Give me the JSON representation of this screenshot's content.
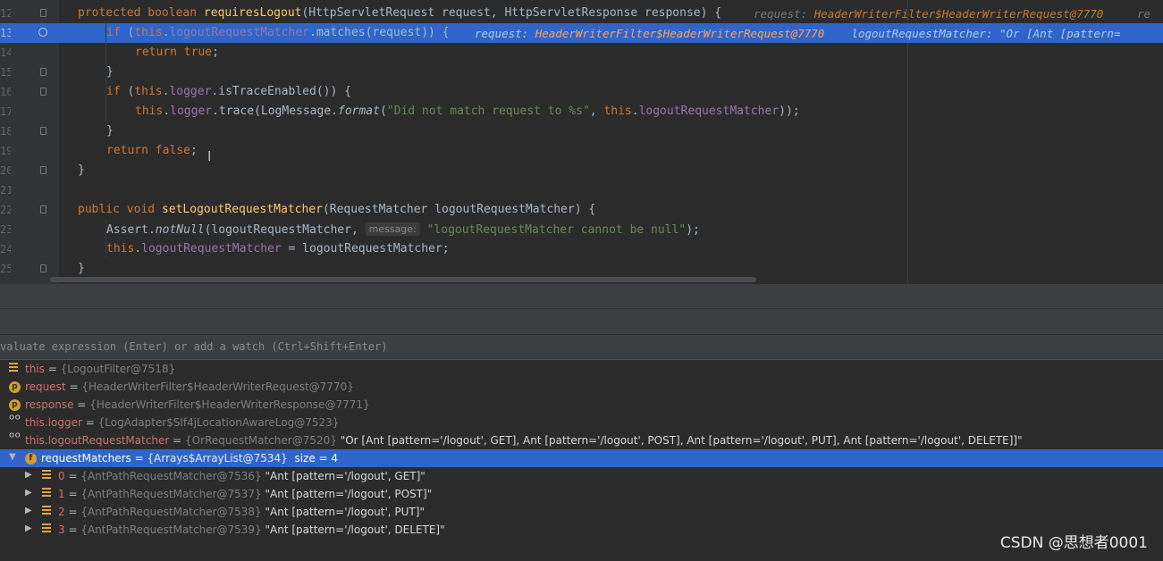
{
  "editor": {
    "lines": [
      {
        "num": "12",
        "code": [
          [
            "kw",
            "protected "
          ],
          [
            "kw",
            "boolean "
          ],
          [
            "fn",
            "requiresLogout"
          ],
          [
            "",
            "(HttpServletRequest request, HttpServletResponse response) {"
          ]
        ],
        "hints": [
          [
            "k",
            "request: "
          ],
          [
            "v",
            "HeaderWriterFilter$HeaderWriterRequest@7770"
          ],
          [
            "k",
            "     re"
          ]
        ]
      },
      {
        "num": "13",
        "code": [
          [
            "kw",
            "if "
          ],
          [
            "",
            "("
          ],
          [
            "kw",
            "this"
          ],
          [
            "",
            "."
          ],
          [
            "fld",
            "logoutRequestMatcher"
          ],
          [
            "",
            ".matches(request)) {"
          ]
        ],
        "hints": [
          [
            "k",
            "request: "
          ],
          [
            "v",
            "HeaderWriterFilter$HeaderWriterRequest@7770"
          ],
          [
            "k",
            "    logoutRequestMatcher: \"Or [Ant [pattern="
          ]
        ]
      },
      {
        "num": "14",
        "code": [
          [
            "kw",
            "return "
          ],
          [
            "kw",
            "true"
          ],
          [
            "",
            ";"
          ]
        ],
        "hints": []
      },
      {
        "num": "15",
        "code": [
          [
            "",
            "}"
          ]
        ],
        "hints": []
      },
      {
        "num": "16",
        "code": [
          [
            "kw",
            "if "
          ],
          [
            "",
            "("
          ],
          [
            "kw",
            "this"
          ],
          [
            "",
            "."
          ],
          [
            "fld",
            "logger"
          ],
          [
            "",
            ".isTraceEnabled()) {"
          ]
        ],
        "hints": []
      },
      {
        "num": "17",
        "code": [
          [
            "kw",
            "this"
          ],
          [
            "",
            "."
          ],
          [
            "fld",
            "logger"
          ],
          [
            "",
            ".trace(LogMessage."
          ],
          [
            "it",
            "format"
          ],
          [
            "",
            "("
          ],
          [
            "str",
            "\"Did not match request to %s\""
          ],
          [
            "",
            ", "
          ],
          [
            "kw",
            "this"
          ],
          [
            "",
            "."
          ],
          [
            "fld",
            "logoutRequestMatcher"
          ],
          [
            "",
            "));"
          ]
        ],
        "hints": []
      },
      {
        "num": "18",
        "code": [
          [
            "",
            "}"
          ]
        ],
        "hints": []
      },
      {
        "num": "19",
        "code": [
          [
            "kw",
            "return "
          ],
          [
            "kw",
            "false"
          ],
          [
            "",
            ";"
          ]
        ],
        "hints": []
      },
      {
        "num": "20",
        "code": [
          [
            "",
            "}"
          ]
        ],
        "hints": []
      },
      {
        "num": "21",
        "code": [],
        "hints": []
      },
      {
        "num": "22",
        "code": [
          [
            "kw",
            "public "
          ],
          [
            "kw",
            "void "
          ],
          [
            "fn",
            "setLogoutRequestMatcher"
          ],
          [
            "",
            "(RequestMatcher logoutRequestMatcher) {"
          ]
        ],
        "hints": []
      },
      {
        "num": "23",
        "code": [
          [
            "",
            "Assert."
          ],
          [
            "it",
            "notNull"
          ],
          [
            "",
            "(logoutRequestMatcher, "
          ],
          [
            "param",
            "message:"
          ],
          [
            "str",
            "\"logoutRequestMatcher cannot be null\""
          ],
          [
            "",
            ");"
          ]
        ],
        "hints": []
      },
      {
        "num": "24",
        "code": [
          [
            "kw",
            "this"
          ],
          [
            "",
            "."
          ],
          [
            "fld",
            "logoutRequestMatcher"
          ],
          [
            "",
            " = logoutRequestMatcher;"
          ]
        ],
        "hints": []
      },
      {
        "num": "25",
        "code": [
          [
            "",
            "}"
          ]
        ],
        "hints": []
      }
    ]
  },
  "debugger": {
    "eval_placeholder": "valuate expression (Enter) or add a watch (Ctrl+Shift+Enter)",
    "variables": [
      {
        "icon": "bars-icon",
        "name": "this",
        "ref": "{LogoutFilter@7518}",
        "value": ""
      },
      {
        "icon": "p",
        "name": "request",
        "ref": "{HeaderWriterFilter$HeaderWriterRequest@7770}",
        "value": ""
      },
      {
        "icon": "p",
        "name": "response",
        "ref": "{HeaderWriterFilter$HeaderWriterResponse@7771}",
        "value": ""
      },
      {
        "icon": "watch-icon",
        "name": "this.logger",
        "ref": "{LogAdapter$Slf4jLocationAwareLog@7523}",
        "value": ""
      },
      {
        "icon": "watch-icon",
        "name": "this.logoutRequestMatcher",
        "ref": "{OrRequestMatcher@7520}",
        "value": " \"Or [Ant [pattern='/logout', GET], Ant [pattern='/logout', POST], Ant [pattern='/logout', PUT], Ant [pattern='/logout', DELETE]]\""
      },
      {
        "icon": "f",
        "name": "requestMatchers",
        "ref": "{Arrays$ArrayList@7534}",
        "value": "  size = 4",
        "expanded": true,
        "selected": true
      },
      {
        "icon": "bars-icon",
        "name": "0",
        "ref": "{AntPathRequestMatcher@7536}",
        "value": " \"Ant [pattern='/logout', GET]\"",
        "child": true
      },
      {
        "icon": "bars-icon",
        "name": "1",
        "ref": "{AntPathRequestMatcher@7537}",
        "value": " \"Ant [pattern='/logout', POST]\"",
        "child": true
      },
      {
        "icon": "bars-icon",
        "name": "2",
        "ref": "{AntPathRequestMatcher@7538}",
        "value": " \"Ant [pattern='/logout', PUT]\"",
        "child": true
      },
      {
        "icon": "bars-icon",
        "name": "3",
        "ref": "{AntPathRequestMatcher@7539}",
        "value": " \"Ant [pattern='/logout', DELETE]\"",
        "child": true
      }
    ]
  },
  "watermark": "CSDN @思想者0001"
}
